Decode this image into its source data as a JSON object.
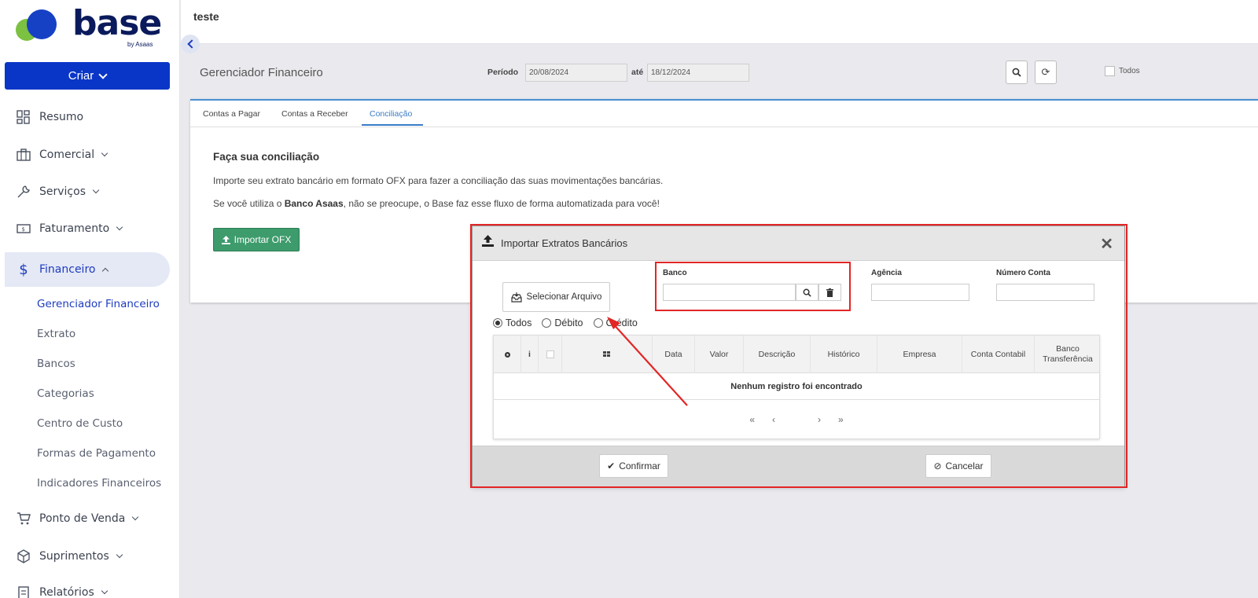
{
  "app": {
    "logo_text": "base",
    "logo_by": "by Asaas",
    "create_button": "Criar",
    "page_header": "teste"
  },
  "sidebar": {
    "items": [
      {
        "label": "Resumo",
        "icon": "dashboard-icon"
      },
      {
        "label": "Comercial",
        "icon": "briefcase-icon"
      },
      {
        "label": "Serviços",
        "icon": "wrench-icon"
      },
      {
        "label": "Faturamento",
        "icon": "money-bill-icon"
      },
      {
        "label": "Financeiro",
        "icon": "dollar-icon"
      },
      {
        "label": "Ponto de Venda",
        "icon": "cart-icon"
      },
      {
        "label": "Suprimentos",
        "icon": "box-icon"
      },
      {
        "label": "Relatórios",
        "icon": "report-icon"
      }
    ],
    "financeiro_sub": [
      "Gerenciador Financeiro",
      "Extrato",
      "Bancos",
      "Categorias",
      "Centro de Custo",
      "Formas de Pagamento",
      "Indicadores Financeiros"
    ]
  },
  "filters": {
    "page_title": "Gerenciador Financeiro",
    "periodo_label": "Período",
    "date_from": "20/08/2024",
    "ate_label": "até",
    "date_to": "18/12/2024",
    "todos_label": "Todos"
  },
  "tabs": [
    "Contas a Pagar",
    "Contas a Receber",
    "Conciliação"
  ],
  "conciliacao": {
    "heading": "Faça sua conciliação",
    "text1": "Importe seu extrato bancário em formato OFX para fazer a conciliação das suas movimentações bancárias.",
    "text2_prefix": "Se você utiliza o ",
    "text2_bold": "Banco Asaas",
    "text2_suffix": ", não se preocupe, o Base faz esse fluxo de forma automatizada para você!",
    "import_button": "Importar OFX"
  },
  "modal": {
    "title": "Importar Extratos Bancários",
    "select_file": "Selecionar Arquivo",
    "banco_label": "Banco",
    "agencia_label": "Agência",
    "numero_conta_label": "Número Conta",
    "radios": [
      "Todos",
      "Débito",
      "Crédito"
    ],
    "columns": [
      "Data",
      "Valor",
      "Descrição",
      "Histórico",
      "Empresa",
      "Conta Contabil",
      "Banco Transferência"
    ],
    "empty_text": "Nenhum registro foi encontrado",
    "confirm": "Confirmar",
    "cancel": "Cancelar"
  },
  "colors": {
    "brand_blue": "#0a36c7",
    "active_tab": "#3a7bc8",
    "import_green": "#3d9b6c",
    "highlight_red": "#e32525"
  }
}
